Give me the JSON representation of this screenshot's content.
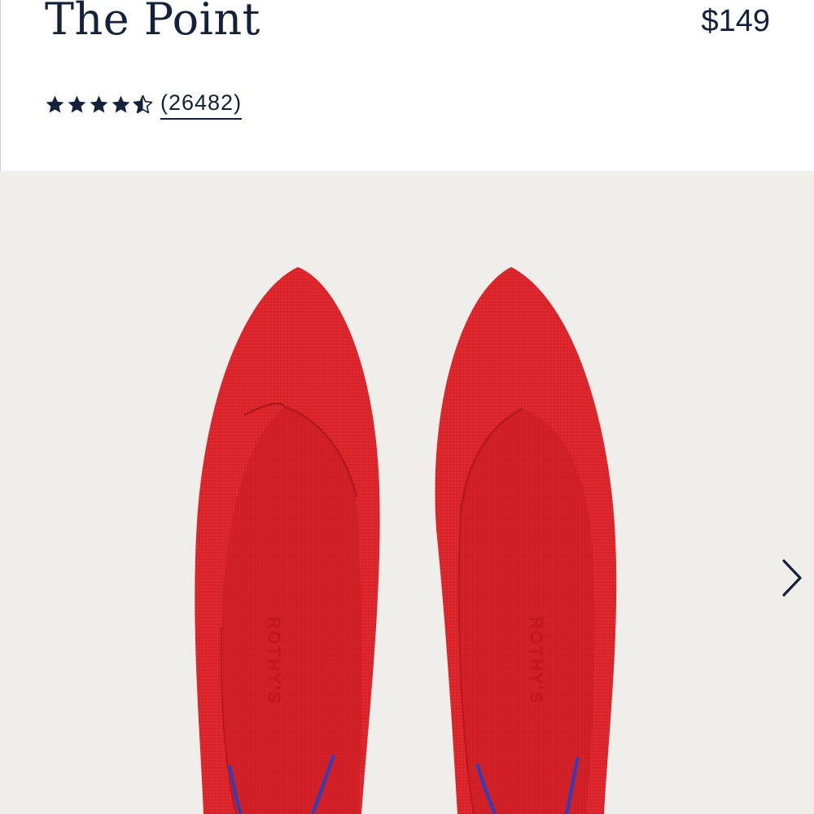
{
  "product": {
    "name": "The Point",
    "price": "$149",
    "rating": 4.5,
    "rating_max": 5,
    "review_count": "(26482)"
  },
  "gallery": {
    "image_description": "Pair of red knit pointed-toe flats",
    "brand_stamp": "ROTHY'S",
    "next_icon": "chevron-right-icon"
  },
  "colors": {
    "text": "#14213d",
    "gallery_background": "#efeeea",
    "shoe_red": "#d9232a",
    "accent_blue": "#2b3fbf"
  }
}
